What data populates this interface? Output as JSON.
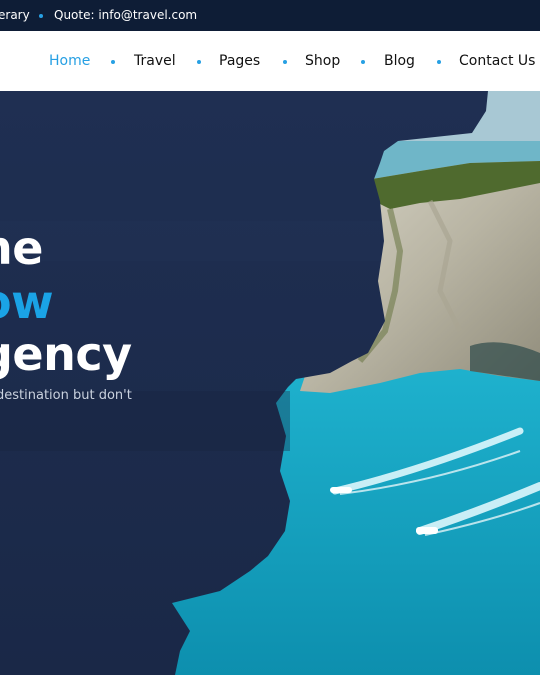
{
  "topbar": {
    "fragment": "erary",
    "quote": "Quote: info@travel.com"
  },
  "nav": {
    "items": [
      {
        "label": "Home",
        "active": true
      },
      {
        "label": "Travel",
        "active": false
      },
      {
        "label": "Pages",
        "active": false
      },
      {
        "label": "Shop",
        "active": false
      },
      {
        "label": "Blog",
        "active": false
      },
      {
        "label": "Contact Us",
        "active": false
      }
    ]
  },
  "hero": {
    "line1": "he",
    "line2": "ow",
    "line3": "gency",
    "subtext": "destination but don't"
  },
  "colors": {
    "accent": "#27a0e3",
    "navy": "#1b2a4a",
    "sea": "#1fb9d3"
  }
}
